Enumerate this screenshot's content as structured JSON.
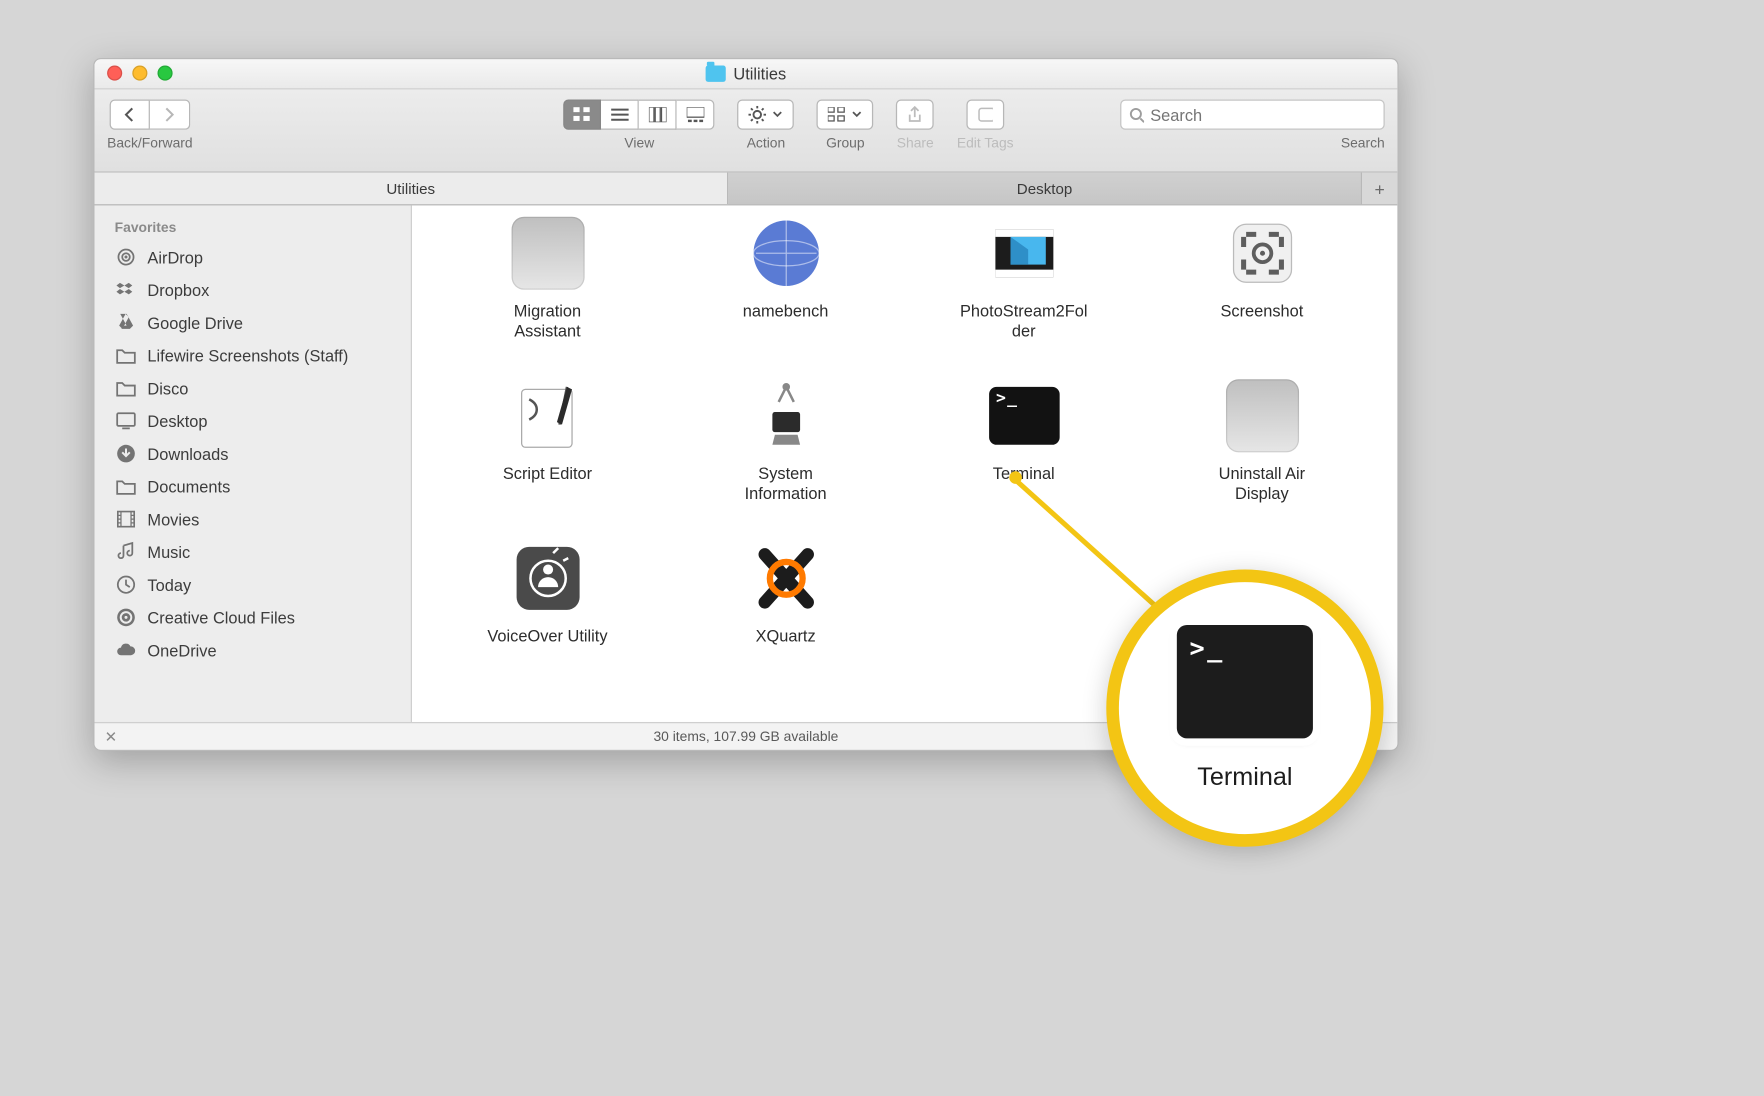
{
  "titlebar": {
    "title": "Utilities"
  },
  "toolbar": {
    "back_forward_label": "Back/Forward",
    "view_label": "View",
    "action_label": "Action",
    "group_label": "Group",
    "share_label": "Share",
    "edit_tags_label": "Edit Tags",
    "search_label": "Search",
    "search_placeholder": "Search"
  },
  "tabs": {
    "items": [
      "Utilities",
      "Desktop"
    ],
    "active_index": 0,
    "add_label": "+"
  },
  "sidebar": {
    "section": "Favorites",
    "items": [
      {
        "icon": "airdrop",
        "label": "AirDrop"
      },
      {
        "icon": "dropbox",
        "label": "Dropbox"
      },
      {
        "icon": "gdrive",
        "label": "Google Drive"
      },
      {
        "icon": "folder",
        "label": "Lifewire Screenshots (Staff)"
      },
      {
        "icon": "folder",
        "label": "Disco"
      },
      {
        "icon": "desktop",
        "label": "Desktop"
      },
      {
        "icon": "downloads",
        "label": "Downloads"
      },
      {
        "icon": "folder",
        "label": "Documents"
      },
      {
        "icon": "movies",
        "label": "Movies"
      },
      {
        "icon": "music",
        "label": "Music"
      },
      {
        "icon": "clock",
        "label": "Today"
      },
      {
        "icon": "cc",
        "label": "Creative Cloud Files"
      },
      {
        "icon": "cloud",
        "label": "OneDrive"
      }
    ]
  },
  "content": {
    "items": [
      {
        "name": "migration-assistant",
        "label": "Migration Assistant",
        "lines": [
          "Migration",
          "Assistant"
        ],
        "icon": "app"
      },
      {
        "name": "namebench",
        "label": "namebench",
        "lines": [
          "namebench"
        ],
        "icon": "globe"
      },
      {
        "name": "photostream2folder",
        "label": "PhotoStream2Folder",
        "lines": [
          "PhotoStream2Fol",
          "der"
        ],
        "icon": "photo"
      },
      {
        "name": "screenshot",
        "label": "Screenshot",
        "lines": [
          "Screenshot"
        ],
        "icon": "screenshot"
      },
      {
        "name": "script-editor",
        "label": "Script Editor",
        "lines": [
          "Script Editor"
        ],
        "icon": "script"
      },
      {
        "name": "system-information",
        "label": "System Information",
        "lines": [
          "System",
          "Information"
        ],
        "icon": "sysinfo"
      },
      {
        "name": "terminal",
        "label": "Terminal",
        "lines": [
          "Terminal"
        ],
        "icon": "terminal"
      },
      {
        "name": "uninstall-air-display",
        "label": "Uninstall Air Display",
        "lines": [
          "Uninstall Air",
          "Display"
        ],
        "icon": "app"
      },
      {
        "name": "voiceover-utility",
        "label": "VoiceOver Utility",
        "lines": [
          "VoiceOver Utility"
        ],
        "icon": "voiceover"
      },
      {
        "name": "xquartz",
        "label": "XQuartz",
        "lines": [
          "XQuartz"
        ],
        "icon": "xquartz"
      }
    ]
  },
  "status": {
    "text": "30 items, 107.99 GB available"
  },
  "callout": {
    "caption": "Terminal"
  }
}
